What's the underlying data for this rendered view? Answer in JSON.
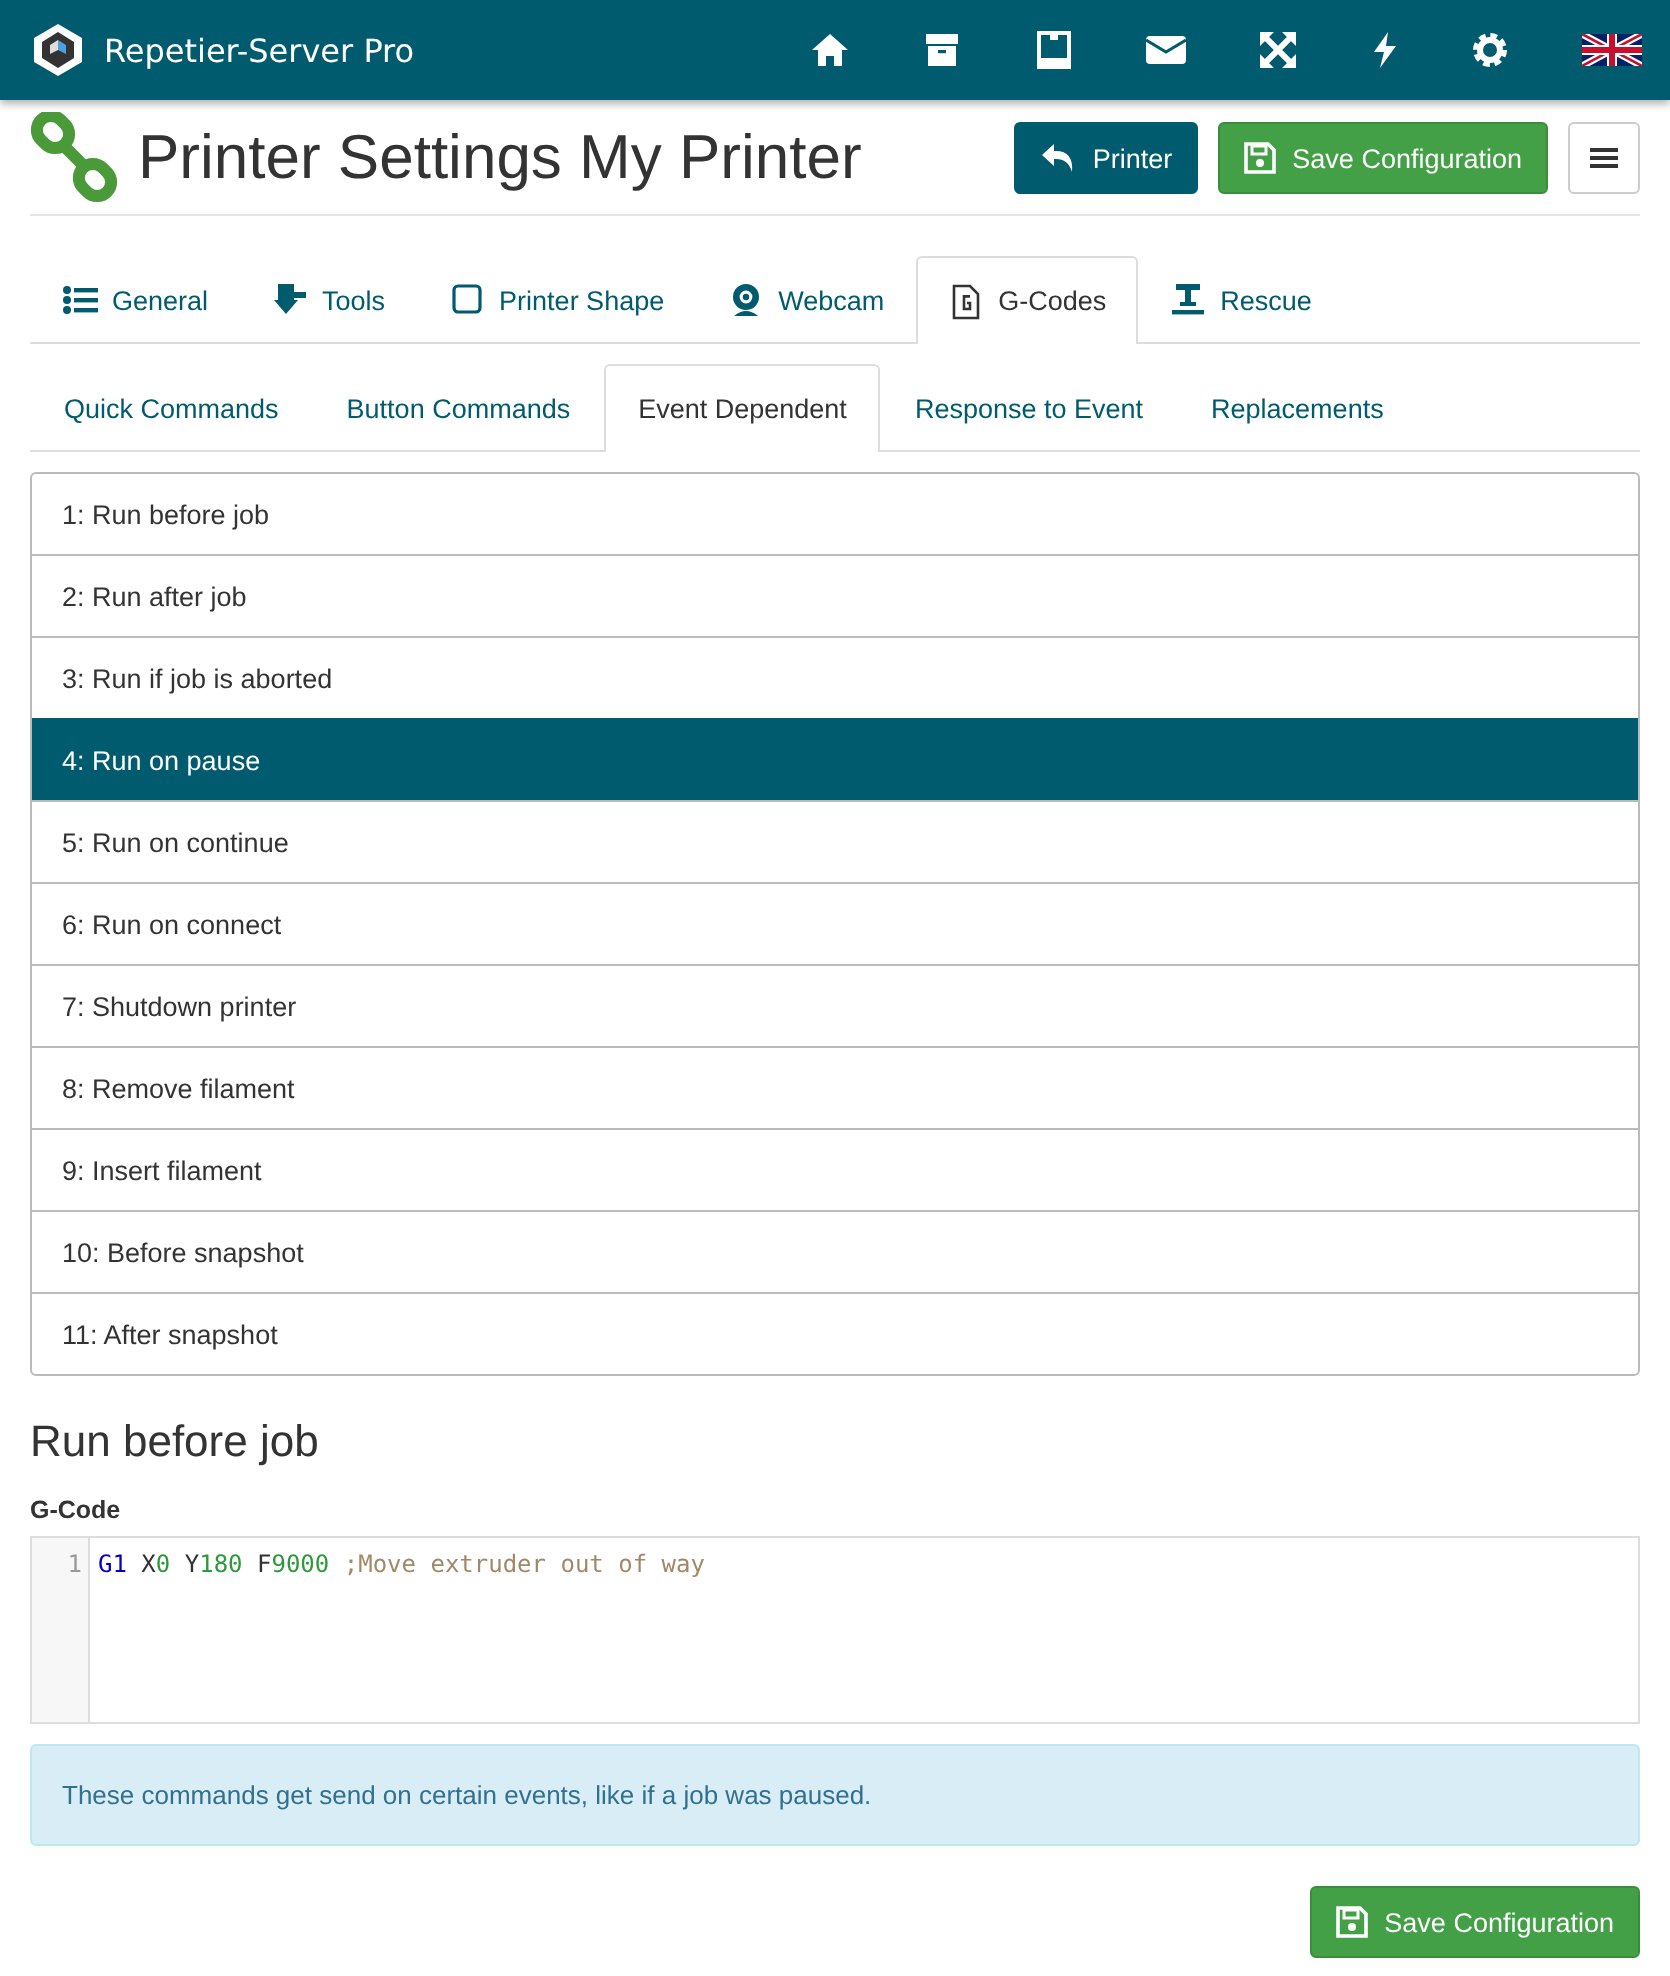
{
  "navbar": {
    "brand": "Repetier-Server Pro",
    "icons": [
      {
        "kind": "home"
      },
      {
        "kind": "archive"
      },
      {
        "kind": "tablet"
      },
      {
        "kind": "mail"
      },
      {
        "kind": "expand"
      },
      {
        "kind": "bolt"
      },
      {
        "kind": "gear"
      },
      {
        "kind": "flag"
      }
    ]
  },
  "header": {
    "title": "Printer Settings My Printer",
    "buttons": [
      {
        "kind": "back",
        "label": "Printer"
      },
      {
        "kind": "save",
        "label": "Save Configuration"
      },
      {
        "kind": "menu"
      }
    ]
  },
  "tabs": [
    {
      "label": "General",
      "kind": "list",
      "selected": false
    },
    {
      "label": "Tools",
      "kind": "tool",
      "selected": false
    },
    {
      "label": "Printer Shape",
      "kind": "square",
      "selected": false
    },
    {
      "label": "Webcam",
      "kind": "webcam",
      "selected": false
    },
    {
      "label": "G-Codes",
      "kind": "file",
      "selected": true
    },
    {
      "label": "Rescue",
      "kind": "rescue",
      "selected": false
    }
  ],
  "subtabs": [
    {
      "label": "Quick Commands",
      "selected": false
    },
    {
      "label": "Button Commands",
      "selected": false
    },
    {
      "label": "Event Dependent",
      "selected": true
    },
    {
      "label": "Response to Event",
      "selected": false
    },
    {
      "label": "Replacements",
      "selected": false
    }
  ],
  "events": [
    {
      "label": "1: Run before job",
      "selected": false
    },
    {
      "label": "2: Run after job",
      "selected": false
    },
    {
      "label": "3: Run if job is aborted",
      "selected": false
    },
    {
      "label": "4: Run on pause",
      "selected": true
    },
    {
      "label": "5: Run on continue",
      "selected": false
    },
    {
      "label": "6: Run on connect",
      "selected": false
    },
    {
      "label": "7: Shutdown printer",
      "selected": false
    },
    {
      "label": "8: Remove filament",
      "selected": false
    },
    {
      "label": "9: Insert filament",
      "selected": false
    },
    {
      "label": "10: Before snapshot",
      "selected": false
    },
    {
      "label": "11: After snapshot",
      "selected": false
    }
  ],
  "section_title": "Run before job",
  "editor": {
    "label": "G-Code",
    "lines": [
      {
        "number": "1",
        "tokens": [
          {
            "kind": "command",
            "text": "G1"
          },
          {
            "kind": "plain",
            "text": " X"
          },
          {
            "kind": "number",
            "text": "0"
          },
          {
            "kind": "plain",
            "text": " Y"
          },
          {
            "kind": "number",
            "text": "180"
          },
          {
            "kind": "plain",
            "text": " F"
          },
          {
            "kind": "number",
            "text": "9000"
          },
          {
            "kind": "comment",
            "text": " ;Move extruder out of way"
          }
        ]
      }
    ]
  },
  "info": "These commands get send on certain events, like if a job was paused.",
  "footer_button": "Save Configuration"
}
